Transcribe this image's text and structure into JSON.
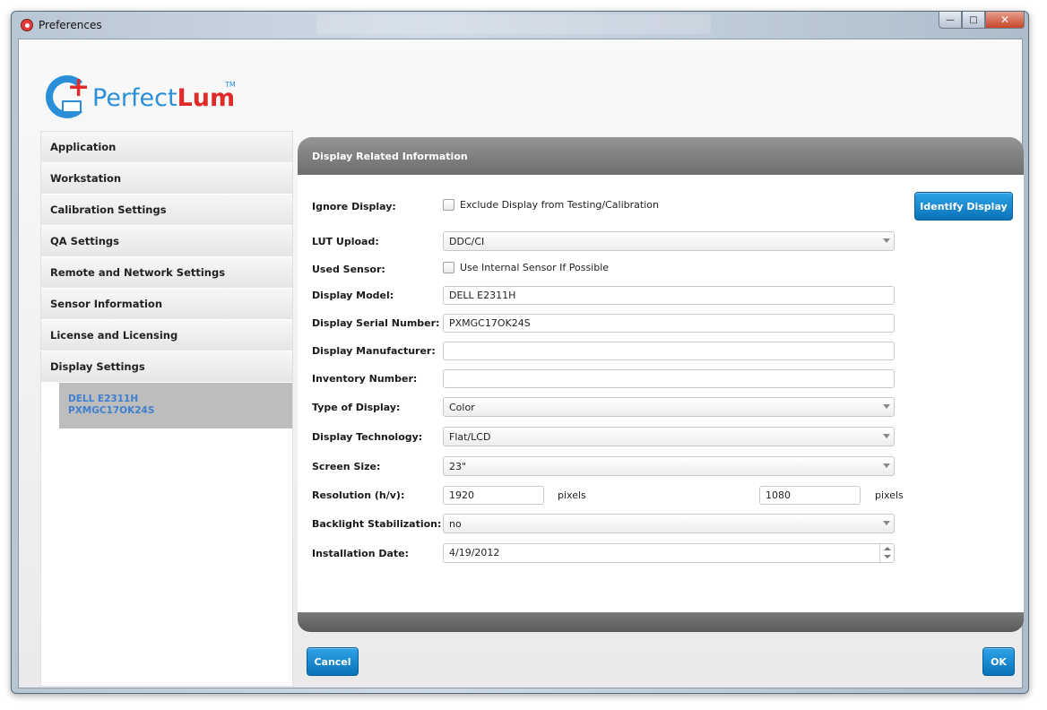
{
  "window": {
    "title": "Preferences"
  },
  "logo": {
    "text_regular": "Perfect",
    "text_bold": "Lum",
    "tm": "TM"
  },
  "sidebar": {
    "items": [
      {
        "label": "Application"
      },
      {
        "label": "Workstation"
      },
      {
        "label": "Calibration Settings"
      },
      {
        "label": "QA Settings"
      },
      {
        "label": "Remote and Network Settings"
      },
      {
        "label": "Sensor Information"
      },
      {
        "label": "License and Licensing"
      },
      {
        "label": "Display Settings"
      }
    ],
    "sub_item": {
      "line1": "DELL E2311H",
      "line2": "PXMGC17OK24S"
    }
  },
  "panel": {
    "title": "Display Related Information",
    "identify_button": "Identify Display",
    "fields": {
      "ignore_display": {
        "label": "Ignore Display:",
        "checkbox_label": "Exclude Display from Testing/Calibration",
        "checked": false
      },
      "lut_upload": {
        "label": "LUT Upload:",
        "value": "DDC/CI"
      },
      "used_sensor": {
        "label": "Used Sensor:",
        "checkbox_label": "Use Internal Sensor If Possible",
        "checked": false
      },
      "display_model": {
        "label": "Display Model:",
        "value": "DELL E2311H"
      },
      "serial_number": {
        "label": "Display Serial Number:",
        "value": "PXMGC17OK24S"
      },
      "manufacturer": {
        "label": "Display Manufacturer:",
        "value": ""
      },
      "inventory_number": {
        "label": "Inventory Number:",
        "value": ""
      },
      "type_of_display": {
        "label": "Type of Display:",
        "value": "Color"
      },
      "display_technology": {
        "label": "Display Technology:",
        "value": "Flat/LCD"
      },
      "screen_size": {
        "label": "Screen Size:",
        "value": "23\""
      },
      "resolution": {
        "label": "Resolution (h/v):",
        "h_value": "1920",
        "v_value": "1080",
        "unit": "pixels"
      },
      "backlight": {
        "label": "Backlight Stabilization:",
        "value": "no"
      },
      "installation_date": {
        "label": "Installation Date:",
        "value": "4/19/2012"
      }
    }
  },
  "footer": {
    "cancel_label": "Cancel",
    "ok_label": "OK"
  }
}
